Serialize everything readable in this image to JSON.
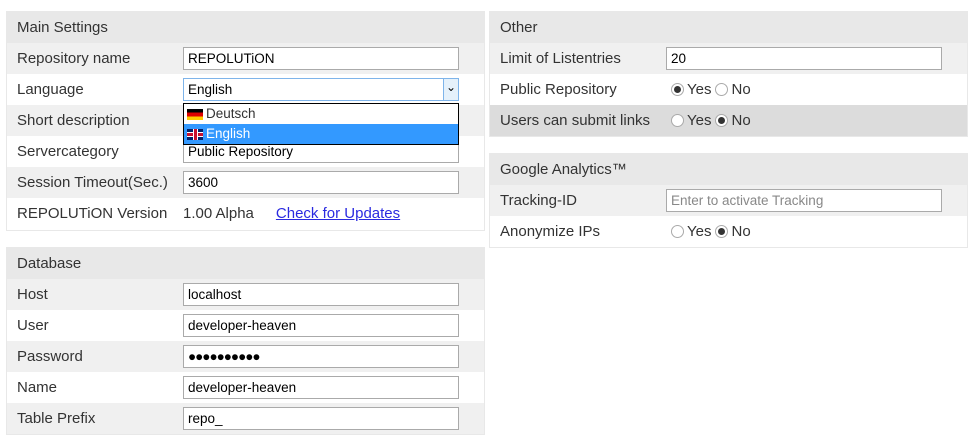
{
  "main": {
    "title": "Main Settings",
    "repo_name_label": "Repository name",
    "repo_name": "REPOLUTiON",
    "language_label": "Language",
    "language": "English",
    "short_desc_label": "Short description",
    "servercat_label": "Servercategory",
    "servercat": "Public Repository",
    "timeout_label": "Session Timeout(Sec.)",
    "timeout": "3600",
    "version_label": "REPOLUTiON Version",
    "version": "1.00 Alpha",
    "check_updates": "Check for Updates"
  },
  "language_dropdown": {
    "options": [
      "Deutsch",
      "English"
    ],
    "selected": "English"
  },
  "database": {
    "title": "Database",
    "host_label": "Host",
    "host": "localhost",
    "user_label": "User",
    "user": "developer-heaven",
    "password_label": "Password",
    "password": "●●●●●●●●●●",
    "name_label": "Name",
    "name": "developer-heaven",
    "prefix_label": "Table Prefix",
    "prefix": "repo_"
  },
  "other": {
    "title": "Other",
    "limit_label": "Limit of Listentries",
    "limit": "20",
    "public_label": "Public Repository",
    "submit_label": "Users can submit links",
    "yes": "Yes",
    "no": "No",
    "public_value": "Yes",
    "submit_value": "No"
  },
  "analytics": {
    "title": "Google Analytics™",
    "tracking_label": "Tracking-ID",
    "tracking_placeholder": "Enter to activate Tracking",
    "anon_label": "Anonymize IPs",
    "anon_value": "No"
  }
}
